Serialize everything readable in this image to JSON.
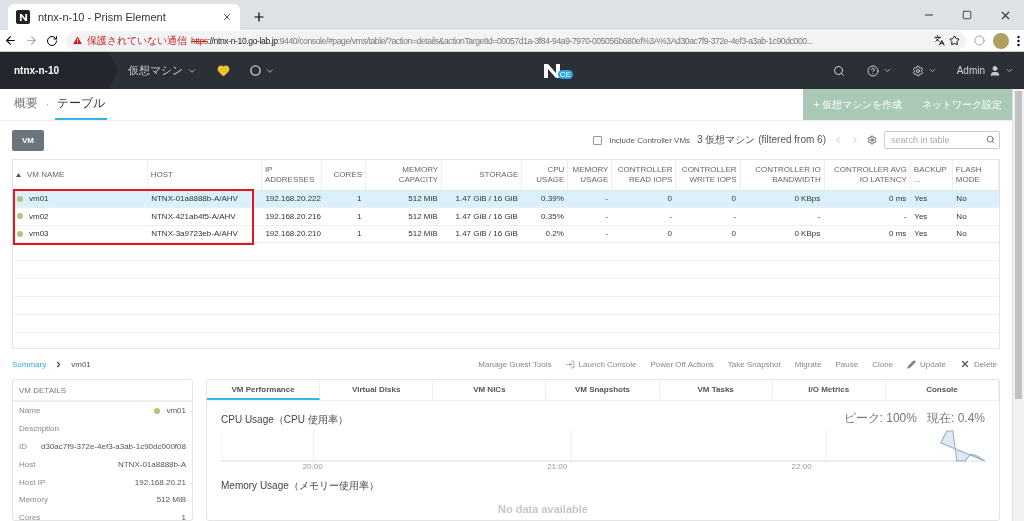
{
  "browser": {
    "tab": {
      "title": "ntnx-n-10 - Prism Element"
    },
    "address": {
      "warning": "保護されていない通信",
      "scheme": "https",
      "host": "://ntnx-n-10.go-lab.jp",
      "path": ":9440/console/#page/vms/table/?action=details&actionTargetId=00057d1a-3f84-94a9-7970-005056b680ef%3A%3Ad30ac7f9-372e-4ef3-a3ab-1c90dc000..."
    }
  },
  "nav": {
    "cluster": "ntnx-n-10",
    "menu": "仮想マシン",
    "logo_badge": "CE",
    "user": "Admin"
  },
  "subtabs": [
    {
      "label": "概要",
      "selected": false
    },
    {
      "label": "テーブル",
      "selected": true
    }
  ],
  "subtab_separator": "·",
  "actions": [
    "+ 仮想マシンを作成",
    "ネットワーク設定"
  ],
  "toolbar": {
    "view_button": "VM",
    "include_controller": {
      "label": "Include Controller VMs",
      "checked": false
    },
    "count": "3 仮想マシン (filtered from 6)",
    "search": {
      "placeholder": "search in table"
    }
  },
  "table": {
    "columns": [
      "VM NAME",
      "HOST",
      "IP ADDRESSES",
      "CORES",
      "MEMORY CAPACITY",
      "STORAGE",
      "CPU USAGE",
      "MEMORY USAGE",
      "CONTROLLER READ IOPS",
      "CONTROLLER WRITE IOPS",
      "CONTROLLER IO BANDWIDTH",
      "CONTROLLER AVG IO LATENCY",
      "BACKUP ...",
      "FLASH MODE"
    ],
    "rows": [
      {
        "selected": true,
        "color": "#a8c97f",
        "cells": [
          "vm01",
          "NTNX-01a8888b-A/AHV",
          "192.168.20.222",
          "1",
          "512 MiB",
          "1.47 GiB / 16 GiB",
          "0.39%",
          "-",
          "0",
          "0",
          "0 KBps",
          "0 ms",
          "Yes",
          "No"
        ]
      },
      {
        "selected": false,
        "color": "#a8c97f",
        "cells": [
          "vm02",
          "NTNX-421ab4f5-A/AHV",
          "192.168.20.216",
          "1",
          "512 MiB",
          "1.47 GiB / 16 GiB",
          "0.35%",
          "-",
          "-",
          "-",
          "-",
          "-",
          "Yes",
          "No"
        ]
      },
      {
        "selected": false,
        "color": "#a8c97f",
        "cells": [
          "vm03",
          "NTNX-3a9723eb-A/AHV",
          "192.168.20.210",
          "1",
          "512 MiB",
          "1.47 GiB / 16 GiB",
          "0.2%",
          "-",
          "0",
          "0",
          "0 KBps",
          "0 ms",
          "Yes",
          "No"
        ]
      }
    ],
    "annotation": {
      "kind": "frame"
    }
  },
  "detail": {
    "breadcrumb": {
      "root": "Summary",
      "current": "vm01"
    },
    "actions": [
      {
        "kind": "plain",
        "label": "Manage Guest Tools"
      },
      {
        "kind": "console",
        "label": "Launch Console"
      },
      {
        "kind": "plain",
        "label": "Power Off Actions"
      },
      {
        "kind": "plain",
        "label": "Take Snapshot"
      },
      {
        "kind": "plain",
        "label": "Migrate"
      },
      {
        "kind": "plain",
        "label": "Pause"
      },
      {
        "kind": "plain",
        "label": "Clone"
      },
      {
        "kind": "edit",
        "label": "Update"
      },
      {
        "kind": "delete",
        "label": "Delete"
      }
    ],
    "vm_details": {
      "title": "VM DETAILS",
      "fields": [
        {
          "label": "Name",
          "value": "vm01",
          "color": "#a8c97f"
        },
        {
          "label": "Description"
        },
        {
          "label": "ID",
          "value": "d30ac7f9-372e-4ef3-a3ab-1c90dc000f08"
        },
        {
          "label": "Host",
          "value": "NTNX-01a8888b-A"
        },
        {
          "label": "Host IP",
          "value": "192.168.20.21"
        },
        {
          "label": "Memory",
          "value": "512 MiB"
        },
        {
          "label": "Cores",
          "value": "1"
        }
      ]
    },
    "tabs": [
      {
        "label": "VM Performance",
        "selected": true
      },
      {
        "label": "Virtual Disks",
        "selected": false
      },
      {
        "label": "VM NICs",
        "selected": false
      },
      {
        "label": "VM Snapshots",
        "selected": false
      },
      {
        "label": "VM Tasks",
        "selected": false
      },
      {
        "label": "I/O Metrics",
        "selected": false
      },
      {
        "label": "Console",
        "selected": false
      }
    ],
    "cpu": {
      "title": "CPU Usage（CPU 使用率）",
      "peak": "ピーク: 100%",
      "current": "現在: 0.4%",
      "times": [
        "20:00",
        "21:00",
        "22:00"
      ]
    },
    "memory": {
      "title": "Memory Usage（メモリー使用率）",
      "empty": "No data available"
    }
  }
}
